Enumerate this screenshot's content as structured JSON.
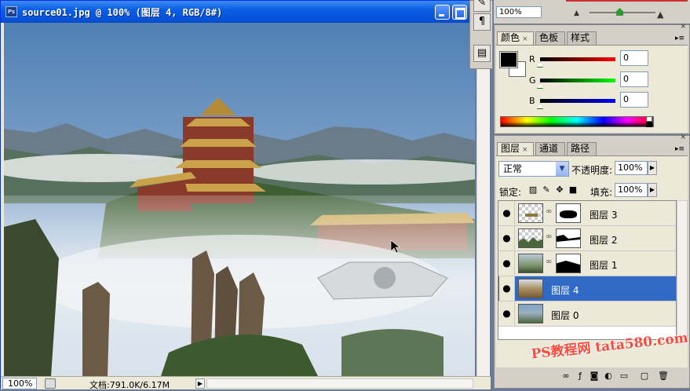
{
  "document": {
    "app_icon": "ps-app-icon",
    "title": "source01.jpg @ 100% (图层 4, RGB/8#)",
    "zoom": "100%",
    "doc_info": "文档:791.0K/6.17M",
    "status_arrow": "▶"
  },
  "navigator": {
    "zoom": "100%"
  },
  "color_panel": {
    "tabs": [
      {
        "label": "颜色"
      },
      {
        "label": "色板"
      },
      {
        "label": "样式"
      }
    ],
    "channels": [
      {
        "label": "R",
        "value": "0",
        "color": "#cc0000"
      },
      {
        "label": "G",
        "value": "0",
        "color": "#00a000"
      },
      {
        "label": "B",
        "value": "0",
        "color": "#0000cc"
      }
    ],
    "foreground": "#000000",
    "background": "#ffffff"
  },
  "layers_panel": {
    "tabs": [
      {
        "label": "图层"
      },
      {
        "label": "通道"
      },
      {
        "label": "路径"
      }
    ],
    "blend_mode": "正常",
    "opacity_label": "不透明度:",
    "opacity": "100%",
    "lock_label": "锁定:",
    "fill_label": "填充:",
    "fill": "100%",
    "layers": [
      {
        "name": "图层 3",
        "visible": true,
        "selected": false,
        "has_mask": true
      },
      {
        "name": "图层 2",
        "visible": true,
        "selected": false,
        "has_mask": true
      },
      {
        "name": "图层 1",
        "visible": true,
        "selected": false,
        "has_mask": true
      },
      {
        "name": "图层 4",
        "visible": true,
        "selected": true,
        "has_mask": false
      },
      {
        "name": "图层 0",
        "visible": true,
        "selected": false,
        "has_mask": false
      }
    ]
  },
  "watermark": "PS教程网 tata580.com"
}
